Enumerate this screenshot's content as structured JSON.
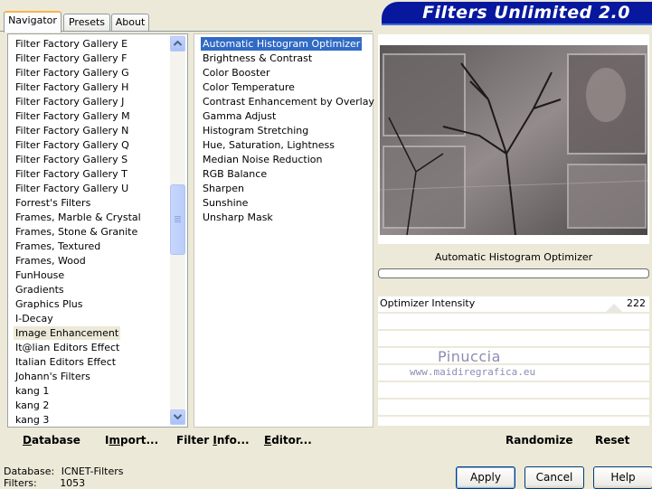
{
  "tabs": {
    "navigator": "Navigator",
    "presets": "Presets",
    "about": "About"
  },
  "title": "Filters Unlimited 2.0",
  "categories": [
    "Filter Factory Gallery E",
    "Filter Factory Gallery F",
    "Filter Factory Gallery G",
    "Filter Factory Gallery H",
    "Filter Factory Gallery J",
    "Filter Factory Gallery M",
    "Filter Factory Gallery N",
    "Filter Factory Gallery Q",
    "Filter Factory Gallery S",
    "Filter Factory Gallery T",
    "Filter Factory Gallery U",
    "Forrest's Filters",
    "Frames, Marble & Crystal",
    "Frames, Stone & Granite",
    "Frames, Textured",
    "Frames, Wood",
    "FunHouse",
    "Gradients",
    "Graphics Plus",
    "I-Decay",
    "Image Enhancement",
    "It@lian Editors Effect",
    "Italian Editors Effect",
    "Johann's Filters",
    "kang 1",
    "kang 2",
    "kang 3"
  ],
  "selected_category": "Image Enhancement",
  "filters": [
    "Automatic Histogram Optimizer",
    "Brightness & Contrast",
    "Color Booster",
    "Color Temperature",
    "Contrast Enhancement by Overlay",
    "Gamma Adjust",
    "Histogram Stretching",
    "Hue, Saturation, Lightness",
    "Median Noise Reduction",
    "RGB Balance",
    "Sharpen",
    "Sunshine",
    "Unsharp Mask"
  ],
  "selected_filter": "Automatic Histogram Optimizer",
  "filter_name_display": "Automatic Histogram Optimizer",
  "params": [
    {
      "label": "Optimizer Intensity",
      "value": "222"
    }
  ],
  "watermark": {
    "line1": "Pinuccia",
    "line2": "www.maidiregrafica.eu"
  },
  "actions": {
    "database_rest": "atabase",
    "database_key": "D",
    "import_pre": "I",
    "import_key": "m",
    "import_rest": "port...",
    "filterinfo_pre": "Filter ",
    "filterinfo_key": "I",
    "filterinfo_rest": "nfo...",
    "editor_key": "E",
    "editor_rest": "ditor...",
    "randomize": "Randomize",
    "reset": "Reset"
  },
  "status": {
    "database_label": "Database:",
    "database_value": "ICNET-Filters",
    "filters_label": "Filters:",
    "filters_value": "1053"
  },
  "buttons": {
    "apply": "Apply",
    "cancel": "Cancel",
    "help": "Help"
  }
}
